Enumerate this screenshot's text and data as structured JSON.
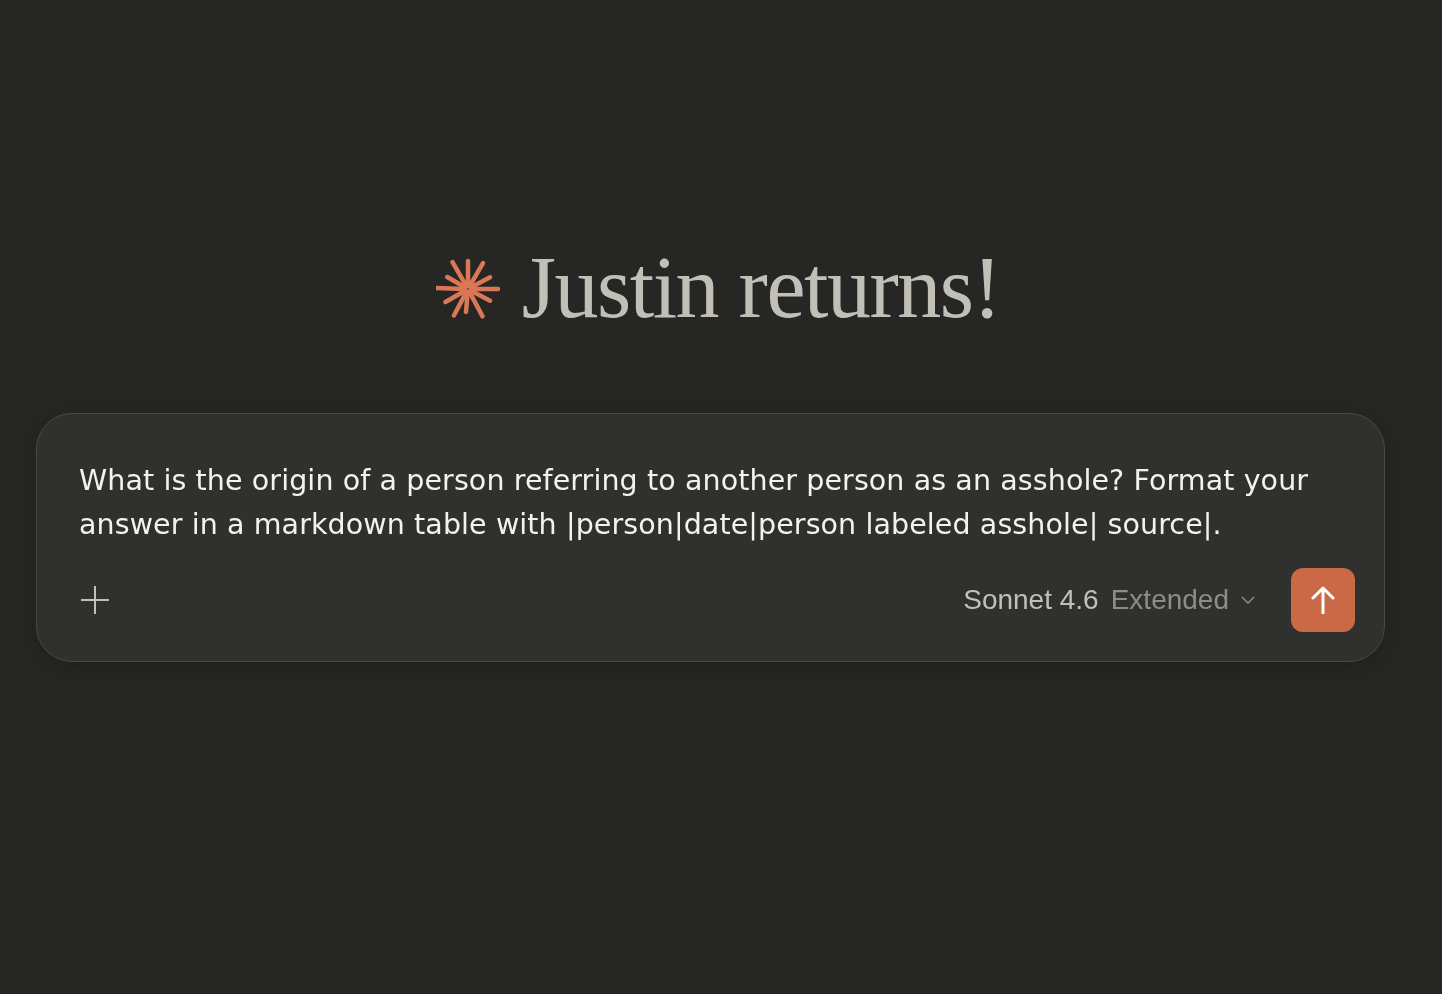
{
  "greeting": {
    "text": "Justin returns!"
  },
  "composer": {
    "value": "What is the origin of a person referring to another person as an asshole? Format your answer in a markdown table with |person|date|person labeled asshole| source|.",
    "model_selector": {
      "model": "Sonnet 4.6",
      "mode": "Extended"
    }
  }
}
